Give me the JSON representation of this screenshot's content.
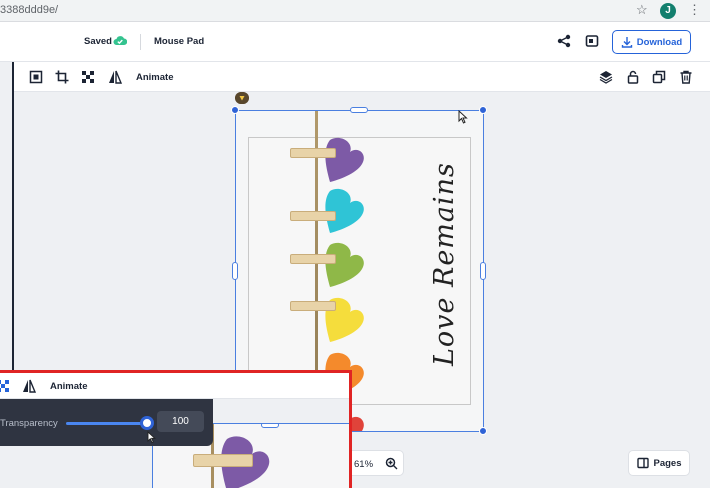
{
  "browser": {
    "url_fragment": "3388ddd9e/",
    "profile_initial": "J"
  },
  "header": {
    "saved_label": "Saved",
    "doc_title": "Mouse Pad",
    "download_label": "Download"
  },
  "toolbar": {
    "animate_label": "Animate"
  },
  "canvas": {
    "script_text": "Love Remains"
  },
  "bottom": {
    "zoom_level": "61%",
    "pages_label": "Pages"
  },
  "inset": {
    "animate_label": "Animate",
    "transparency_label": "Transparency",
    "transparency_value": "100",
    "transparency_level_percent": 100
  },
  "colors": {
    "accent": "#2563d9",
    "selection": "#4a7fe0",
    "highlight_border": "#e02424",
    "panel_dark": "#2f3441",
    "avatar_bg": "#137f6e",
    "cloud_check": "#34c38f",
    "heart_purple": "#7d5aa6",
    "heart_cyan": "#2fc4d6",
    "heart_green": "#8fb848",
    "heart_yellow": "#f5dd3c",
    "heart_orange": "#f48a2c",
    "heart_red": "#e0433a"
  },
  "icons": [
    "star-icon",
    "kebab-icon",
    "cloud-check-icon",
    "share-icon",
    "present-icon",
    "download-icon",
    "resize-icon",
    "crop-icon",
    "transparency-icon",
    "flip-icon",
    "layers-icon",
    "unlock-icon",
    "duplicate-icon",
    "trash-icon",
    "lock-badge-icon",
    "zoom-in-icon",
    "pages-icon",
    "cursor-icon"
  ]
}
